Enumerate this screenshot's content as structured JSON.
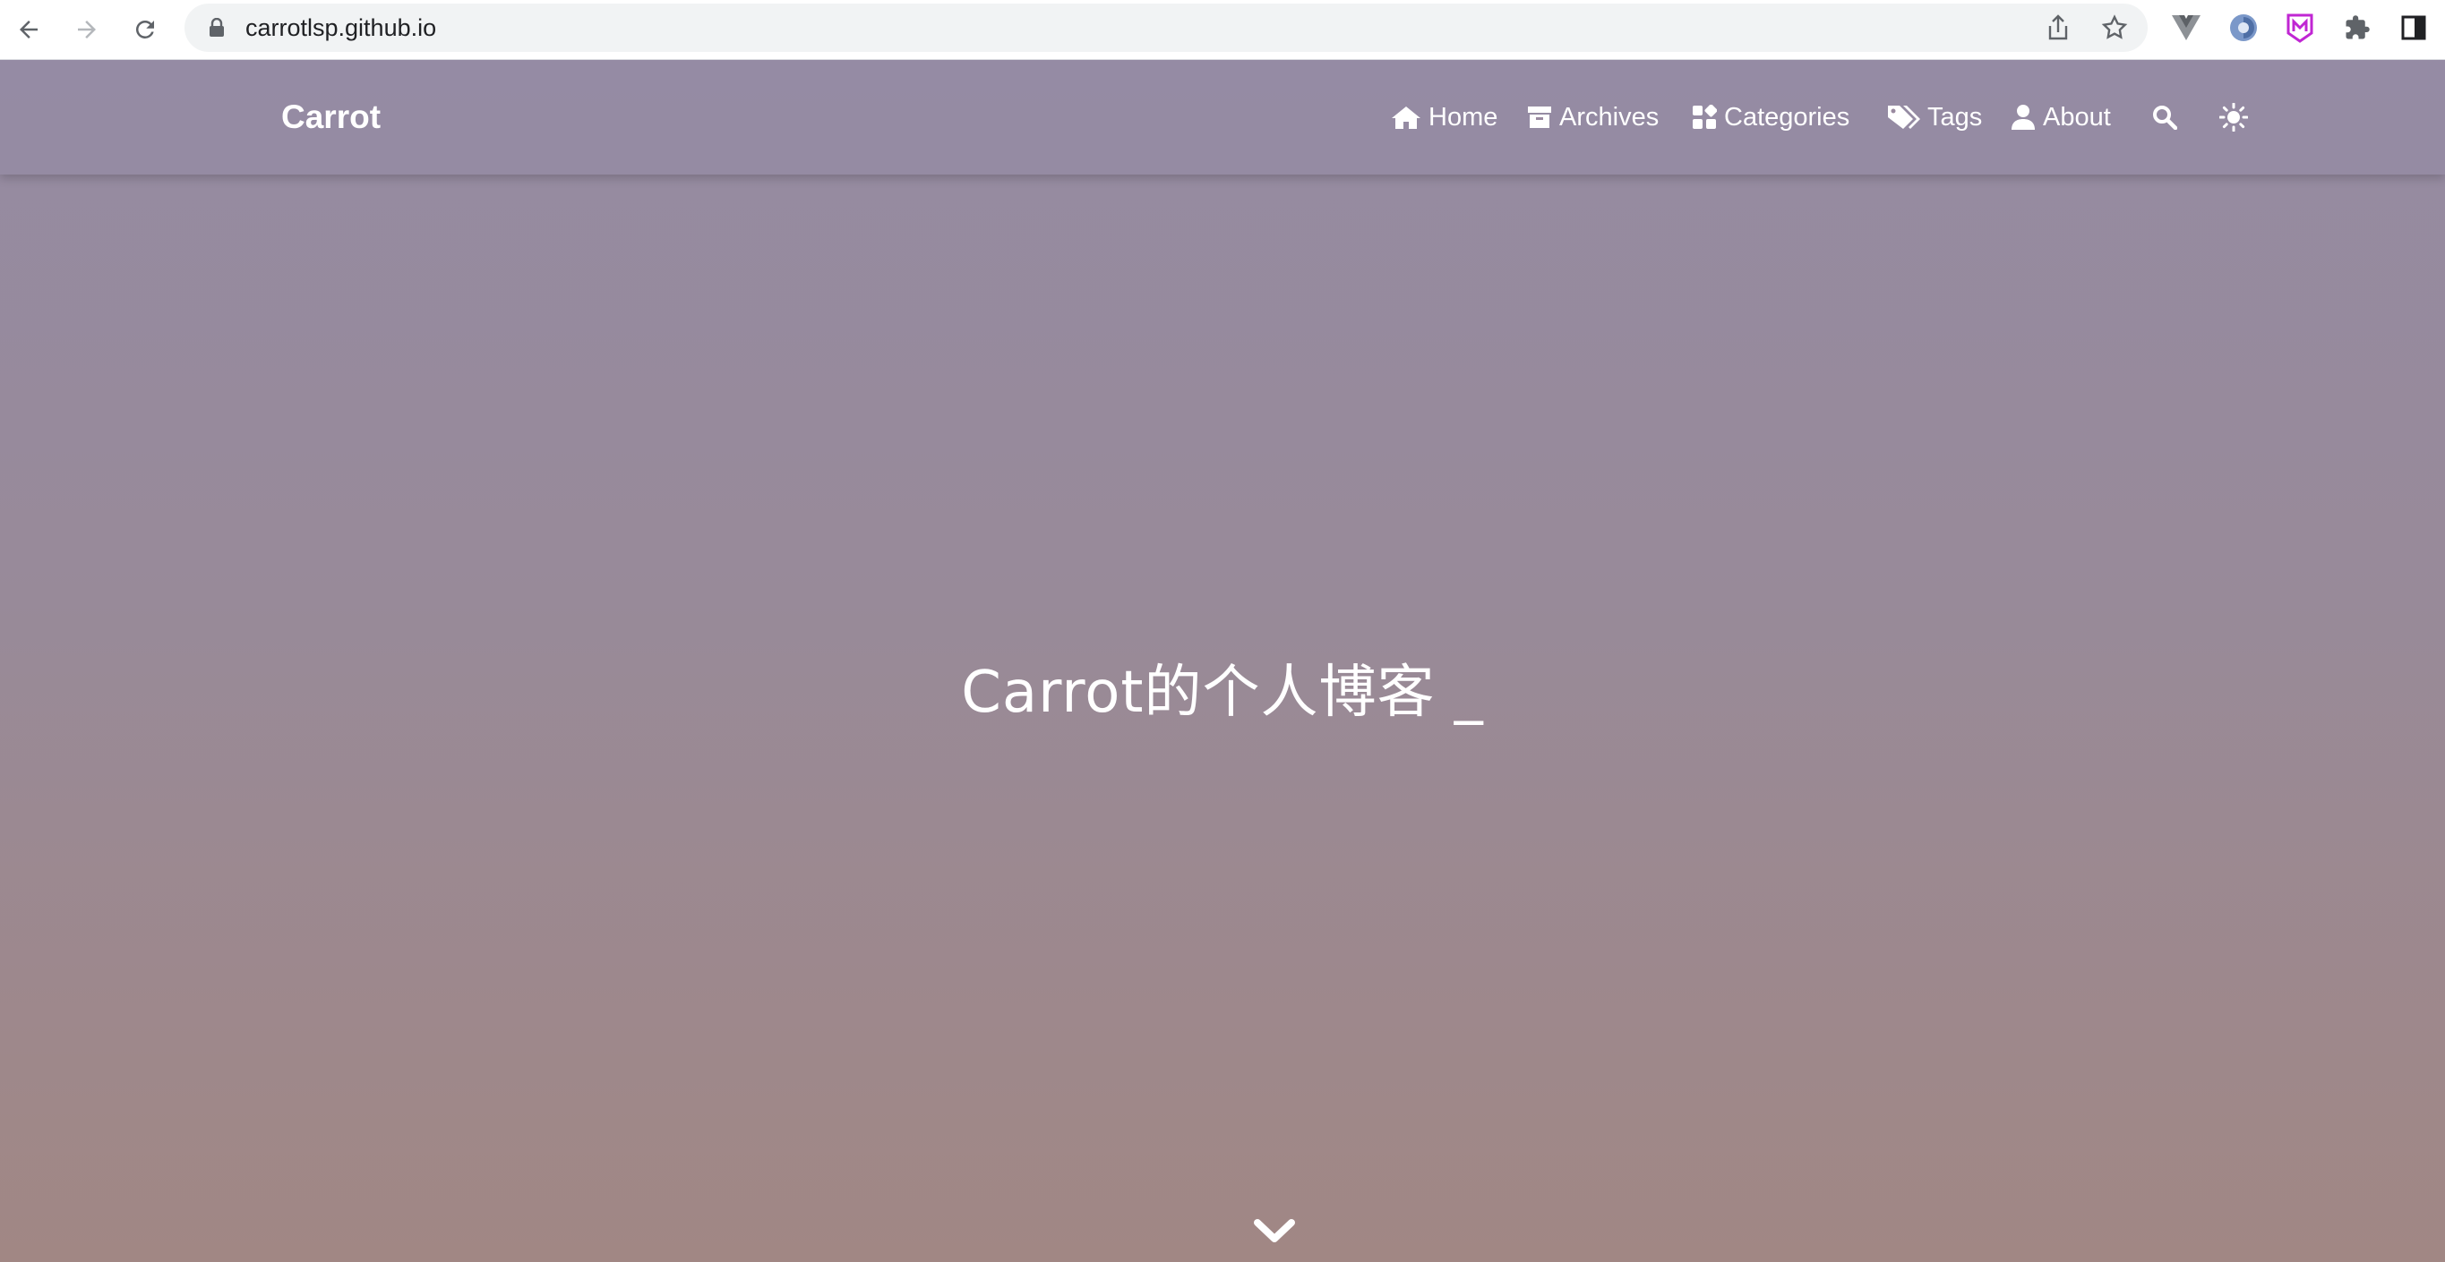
{
  "browser": {
    "url": "carrotlsp.github.io",
    "back_icon": "arrow-left-icon",
    "forward_icon": "arrow-right-icon",
    "reload_icon": "reload-icon",
    "lock_icon": "lock-icon",
    "share_icon": "share-icon",
    "bookmark_icon": "star-icon",
    "extensions": [
      "vue-devtools-icon",
      "extension-blue-icon",
      "extension-m-icon",
      "puzzle-icon",
      "sidebar-icon"
    ]
  },
  "site": {
    "brand": "Carrot",
    "nav": [
      {
        "label": "Home",
        "icon": "home-icon"
      },
      {
        "label": "Archives",
        "icon": "archive-icon"
      },
      {
        "label": "Categories",
        "icon": "categories-icon"
      },
      {
        "label": "Tags",
        "icon": "tags-icon"
      },
      {
        "label": "About",
        "icon": "user-icon"
      }
    ],
    "search_icon": "search-icon",
    "theme_icon": "sun-icon"
  },
  "hero": {
    "title": "Carrot的个人博客 _"
  },
  "colors": {
    "gradient_top": "#958ba2",
    "gradient_bottom": "#a18784",
    "nav_text": "#ffffff"
  }
}
